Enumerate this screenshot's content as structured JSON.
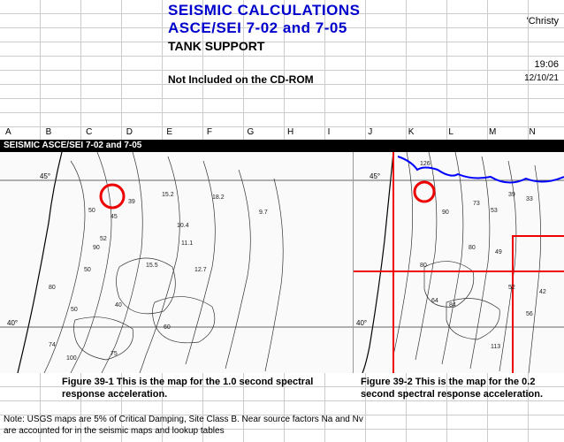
{
  "header": {
    "title_line1": "SEISMIC CALCULATIONS",
    "title_line2": "ASCE/SEI 7-02 and 7-05",
    "subtitle": "TANK SUPPORT",
    "cdrom_note": "Not Included on the CD-ROM",
    "author": "'Christy",
    "time": "19:06",
    "date": "12/10/21"
  },
  "columns": [
    "A",
    "B",
    "C",
    "D",
    "E",
    "F",
    "G",
    "H",
    "I",
    "J",
    "K",
    "L",
    "M",
    "N"
  ],
  "black_bar": "SEISMIC  ASCE/SEI 7-02 and 7-05",
  "map_left": {
    "lat_top": "45°",
    "lat_bot": "40°",
    "contour_labels": [
      "10.4",
      "11.1",
      "12.7",
      "15.5",
      "15.2",
      "18.2",
      "9.7",
      "39",
      "45",
      "52",
      "50",
      "90",
      "50",
      "50",
      "80",
      "74",
      "40",
      "60",
      "100",
      "75"
    ]
  },
  "map_right": {
    "lat_top": "45°",
    "lat_bot": "40°",
    "contour_labels": [
      "33",
      "39",
      "53",
      "64",
      "80",
      "90",
      "84",
      "49",
      "80",
      "52",
      "56",
      "42",
      "113",
      "126",
      "73"
    ]
  },
  "captions": {
    "left": "Figure 39-1 This is the map for the 1.0 second spectral response acceleration.",
    "right": "Figure 39-2 This is the map for the 0.2 second spectral response acceleration."
  },
  "footnote": "Note:  USGS maps are 5% of Critical Damping, Site Class B. Near source factors Na and Nv are accounted for in the seismic maps and lookup tables"
}
